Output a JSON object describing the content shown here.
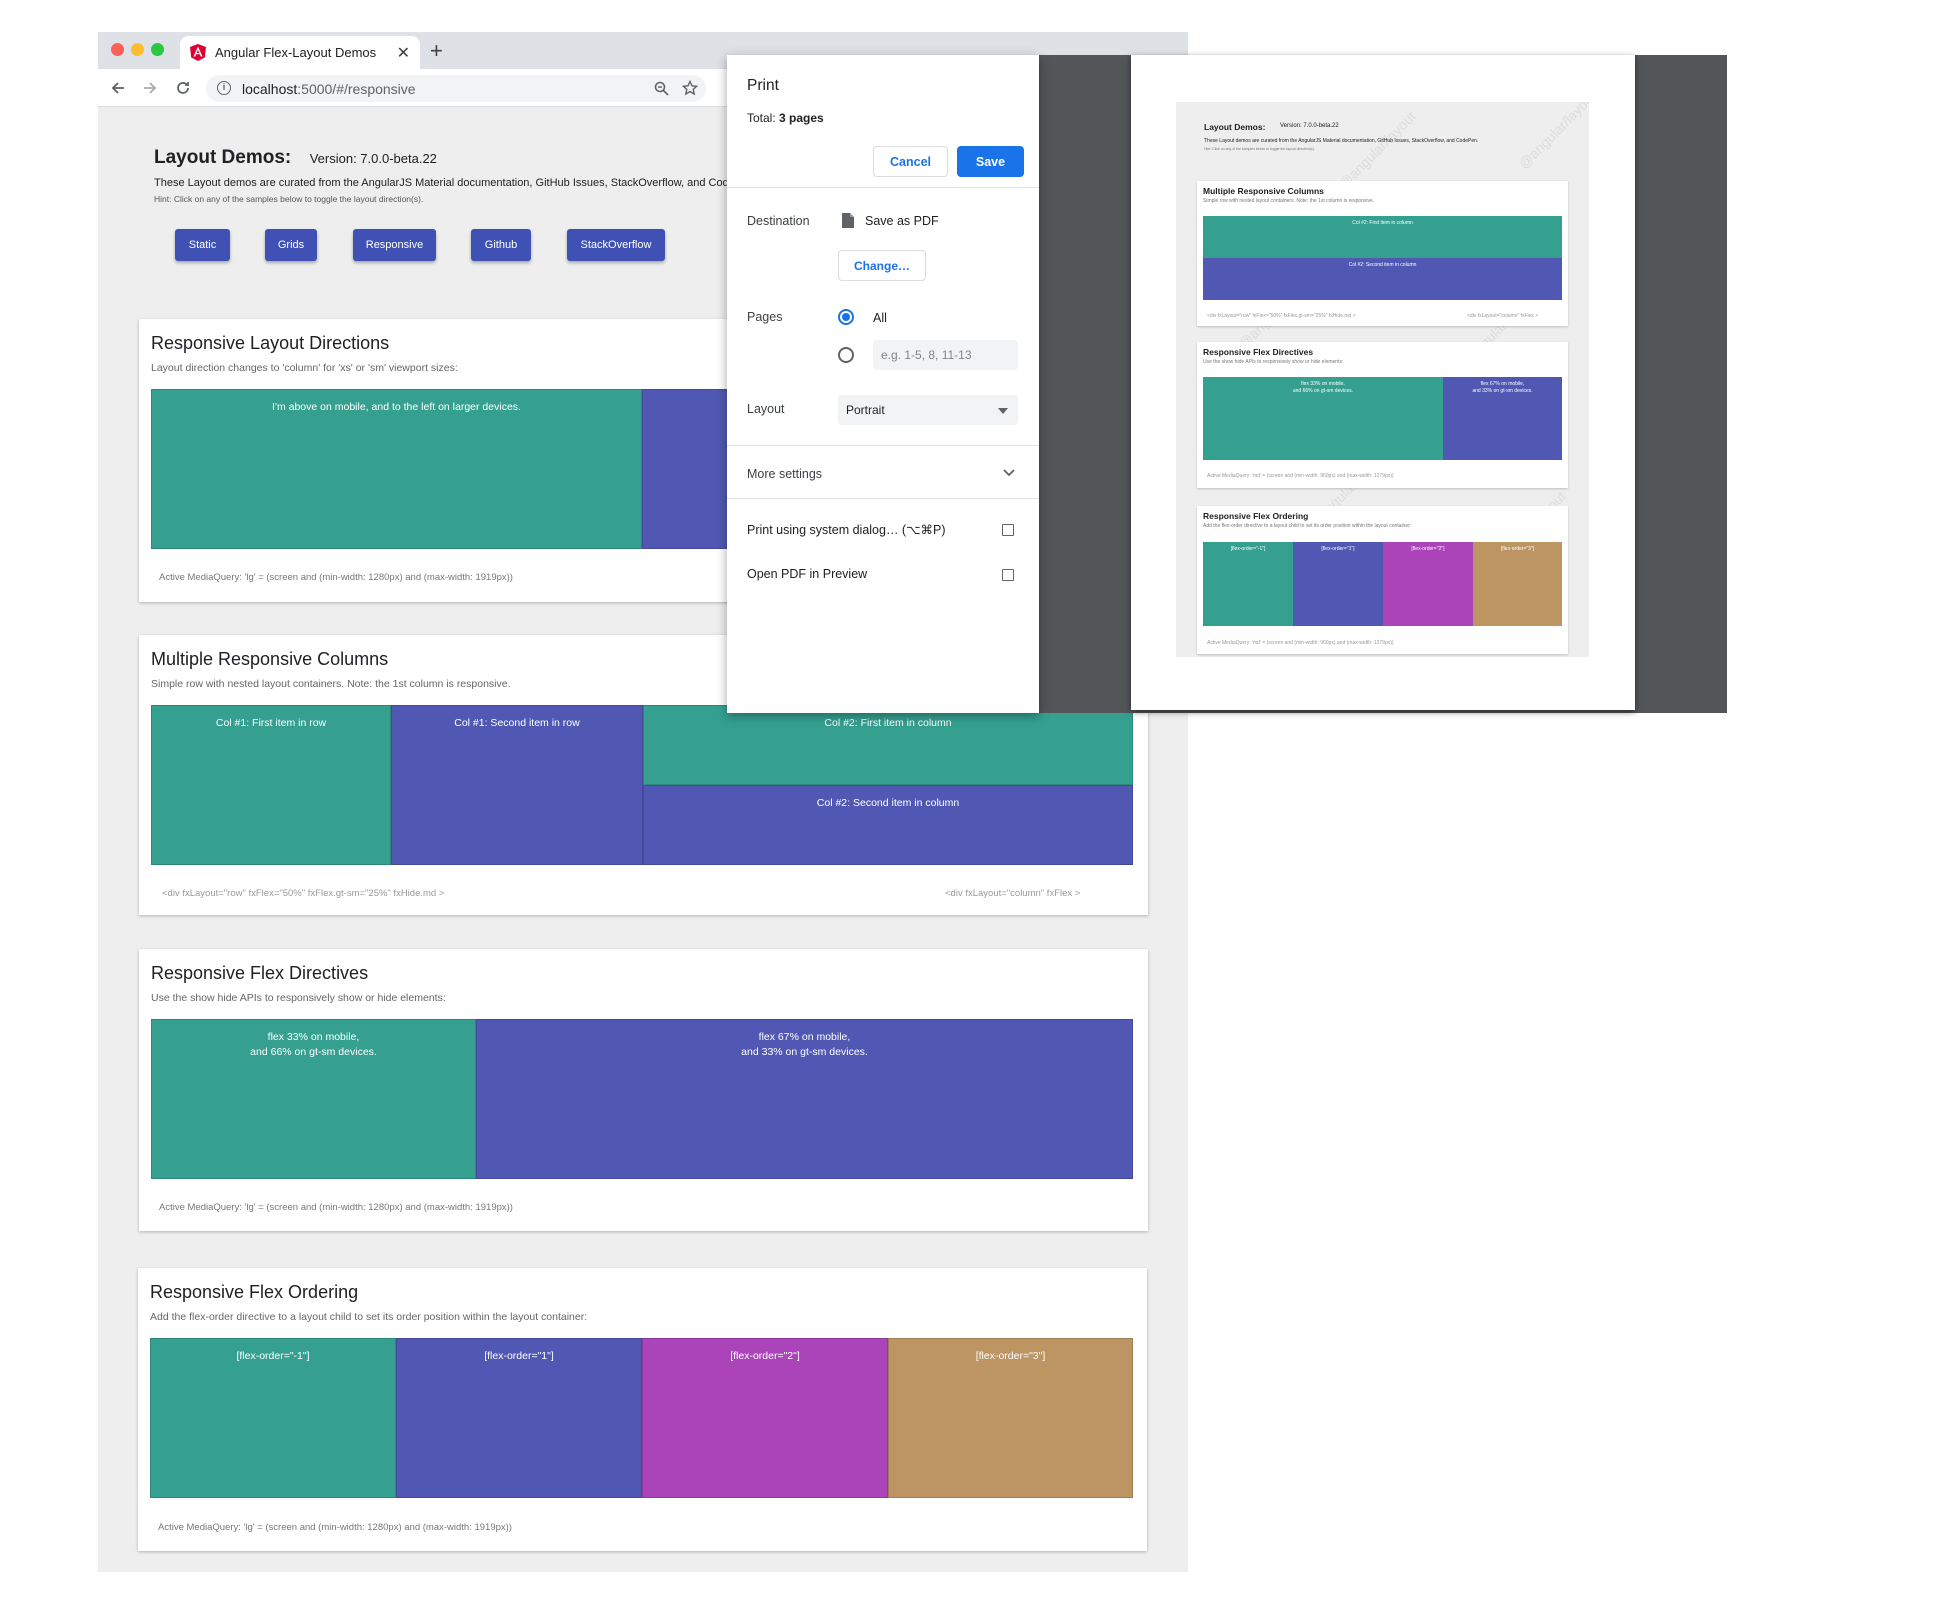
{
  "browser": {
    "tab_title": "Angular Flex-Layout Demos",
    "tab_close": "✕",
    "new_tab": "+",
    "url_host": "localhost",
    "url_path": ":5000/#/responsive",
    "icons": {
      "back": "arrow-left",
      "forward": "arrow-right",
      "reload": "reload",
      "zoom": "zoom",
      "bookmark": "star"
    }
  },
  "page": {
    "title": "Layout Demos:",
    "version": "Version: 7.0.0-beta.22",
    "description": "These Layout demos are curated from the AngularJS Material documentation, GitHub Issues, StackOverflow, and CodeF",
    "hint": "Hint: Click on any of the samples below to toggle the layout direction(s).",
    "nav_buttons": [
      "Static",
      "Grids",
      "Responsive",
      "Github",
      "StackOverflow"
    ],
    "colors": {
      "teal": "#35a090",
      "indigo": "#5058b3",
      "purple": "#aa44b8",
      "tan": "#bc9563",
      "button": "#3f51b5"
    }
  },
  "cards": {
    "directions": {
      "title": "Responsive Layout Directions",
      "subtitle": "Layout direction changes to 'column' for 'xs' or 'sm' viewport sizes:",
      "box1": "I'm above on mobile, and to the left on larger devices.",
      "footer": "Active MediaQuery: 'lg' = (screen and (min-width: 1280px) and (max-width: 1919px))"
    },
    "columns": {
      "title": "Multiple Responsive Columns",
      "subtitle": "Simple row with nested layout containers. Note: the 1st column is responsive.",
      "box1": "Col #1: First item in row",
      "box2": "Col #1: Second item in row",
      "box3": "Col #2: First item in column",
      "box4": "Col #2: Second item in column",
      "footer_left": "<div fxLayout=\"row\" fxFlex=\"50%\" fxFlex.gt-sm=\"25%\" fxHide.md >",
      "footer_right": "<div fxLayout=\"column\" fxFlex >"
    },
    "flex": {
      "title": "Responsive Flex Directives",
      "subtitle": "Use the show hide APIs to responsively show or hide elements:",
      "box1_line1": "flex 33% on mobile,",
      "box1_line2": "and 66% on gt-sm devices.",
      "box2_line1": "flex 67% on mobile,",
      "box2_line2": "and 33% on gt-sm devices.",
      "footer": "Active MediaQuery: 'lg' = (screen and (min-width: 1280px) and (max-width: 1919px))"
    },
    "ordering": {
      "title": "Responsive Flex Ordering",
      "subtitle": "Add the flex-order directive to a layout child to set its order position within the layout container:",
      "boxes": [
        "[flex-order=\"-1\"]",
        "[flex-order=\"1\"]",
        "[flex-order=\"2\"]",
        "[flex-order=\"3\"]"
      ],
      "footer": "Active MediaQuery: 'lg' = (screen and (min-width: 1280px) and (max-width: 1919px))"
    }
  },
  "print_dialog": {
    "title": "Print",
    "total_label": "Total: ",
    "total_value": "3 pages",
    "cancel": "Cancel",
    "save": "Save",
    "destination_label": "Destination",
    "destination_value": "Save as PDF",
    "change": "Change…",
    "pages_label": "Pages",
    "pages_all": "All",
    "pages_placeholder": "e.g. 1-5, 8, 11-13",
    "layout_label": "Layout",
    "layout_value": "Portrait",
    "more_settings": "More settings",
    "system_dialog": "Print using system dialog… (⌥⌘P)",
    "open_pdf": "Open PDF in Preview",
    "accent": "#1a73e8"
  },
  "preview": {
    "title": "Layout Demos:",
    "version": "Version: 7.0.0-beta.22",
    "description": "These Layout demos are curated from the AngularJS Material documentation, GitHub Issues, StackOverflow, and CodePen.",
    "hint": "Hint: Click on any of the samples below to toggle the layout direction(s).",
    "card1_title": "Multiple Responsive Columns",
    "card1_sub": "Simple row with nested layout containers. Note: the 1st column is responsive.",
    "card1_box1": "Col #2: First item in column",
    "card1_box2": "Col #2: Second item in column",
    "card1_foot_left": "<div fxLayout=\"row\" fxFlex=\"50%\" fxFlex.gt-sm=\"25%\" fxHide.md >",
    "card1_foot_right": "<div fxLayout=\"column\" fxFlex >",
    "card2_title": "Responsive Flex Directives",
    "card2_sub": "Use the show hide APIs to responsively show or hide elements:",
    "card2_box1_line1": "flex 33% on mobile,",
    "card2_box1_line2": "and 66% on gt-sm devices.",
    "card2_box2_line1": "flex 67% on mobile,",
    "card2_box2_line2": "and 33% on gt-sm devices.",
    "card2_foot": "Active MediaQuery: 'md' = (screen and (min-width: 960px) and (max-width: 1279px))",
    "card3_title": "Responsive Flex Ordering",
    "card3_sub": "Add the flex-order directive to a layout child to set its order position within the layout container:",
    "card3_boxes": [
      "[flex-order=\"-1\"]",
      "[flex-order=\"1\"]",
      "[flex-order=\"2\"]",
      "[flex-order=\"3\"]"
    ],
    "card3_foot": "Active MediaQuery: 'md' = (screen and (min-width: 960px) and (max-width: 1279px))",
    "watermark": "@angular/layout"
  }
}
